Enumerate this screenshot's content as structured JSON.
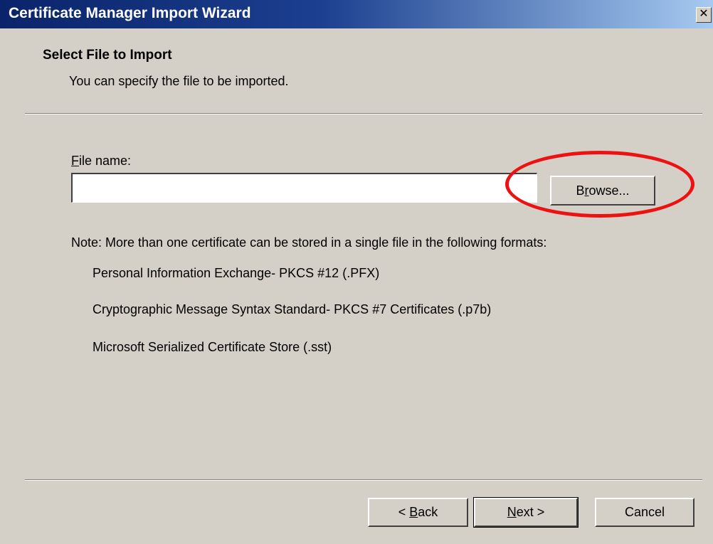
{
  "window": {
    "title": "Certificate Manager Import Wizard",
    "close_glyph": "✕"
  },
  "header": {
    "title": "Select File to Import",
    "subtitle": "You can specify the file to be imported."
  },
  "file": {
    "label_accel": "F",
    "label_rest": "ile name:",
    "value": "",
    "placeholder": ""
  },
  "browse": {
    "pre": "B",
    "accel": "r",
    "post": "owse..."
  },
  "note": "Note:  More than one certificate can be stored in a single file in the following formats:",
  "formats": [
    "Personal Information Exchange- PKCS #12 (.PFX)",
    "Cryptographic Message Syntax Standard- PKCS #7 Certificates (.p7b)",
    "Microsoft Serialized Certificate Store (.sst)"
  ],
  "buttons": {
    "back_prefix": "< ",
    "back_accel": "B",
    "back_rest": "ack",
    "next_accel": "N",
    "next_rest": "ext >",
    "cancel": "Cancel"
  },
  "colors": {
    "titlebar_start": "#0a246a",
    "titlebar_end": "#a6caf0",
    "dialog_bg": "#d4d0c8",
    "highlight": "#ee1111"
  }
}
